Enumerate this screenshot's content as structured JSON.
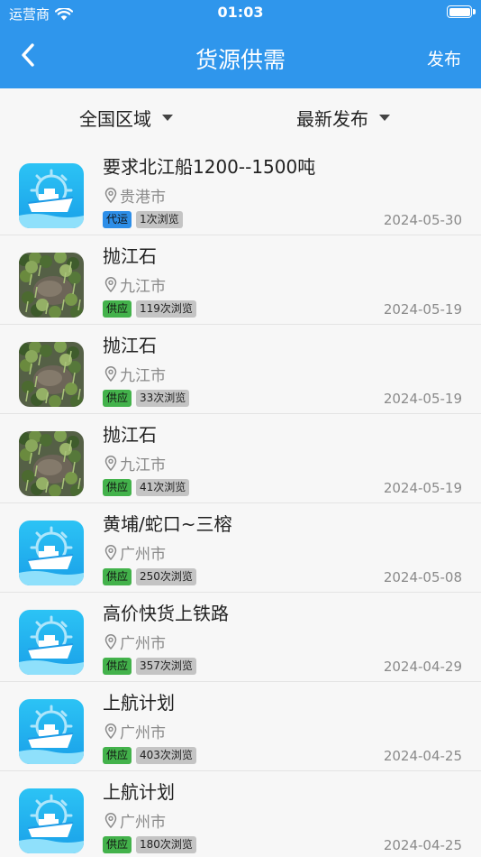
{
  "status_bar": {
    "carrier": "运营商",
    "time": "01:03"
  },
  "navbar": {
    "back_icon": "chevron-left-icon",
    "title": "货源供需",
    "publish_label": "发布"
  },
  "filters": {
    "region": "全国区域",
    "sort": "最新发布"
  },
  "colors": {
    "header": "#2f96ec",
    "tag_blue": "#2d8ee8",
    "tag_green": "#43b24b",
    "tag_gray": "#c4c4c4"
  },
  "items": [
    {
      "thumb": "ship-icon",
      "title": "要求北江船1200--1500吨",
      "location": "贵港市",
      "type": "代运",
      "type_color": "blue",
      "views": "1次浏览",
      "date": "2024-05-30"
    },
    {
      "thumb": "rock-photo",
      "title": "抛江石",
      "location": "九江市",
      "type": "供应",
      "type_color": "green",
      "views": "119次浏览",
      "date": "2024-05-19"
    },
    {
      "thumb": "rock-photo",
      "title": "抛江石",
      "location": "九江市",
      "type": "供应",
      "type_color": "green",
      "views": "33次浏览",
      "date": "2024-05-19"
    },
    {
      "thumb": "rock-photo",
      "title": "抛江石",
      "location": "九江市",
      "type": "供应",
      "type_color": "green",
      "views": "41次浏览",
      "date": "2024-05-19"
    },
    {
      "thumb": "ship-icon",
      "title": "黄埔/蛇口~三榕",
      "location": "广州市",
      "type": "供应",
      "type_color": "green",
      "views": "250次浏览",
      "date": "2024-05-08"
    },
    {
      "thumb": "ship-icon",
      "title": "高价快货上铁路",
      "location": "广州市",
      "type": "供应",
      "type_color": "green",
      "views": "357次浏览",
      "date": "2024-04-29"
    },
    {
      "thumb": "ship-icon",
      "title": "上航计划",
      "location": "广州市",
      "type": "供应",
      "type_color": "green",
      "views": "403次浏览",
      "date": "2024-04-25"
    },
    {
      "thumb": "ship-icon",
      "title": "上航计划",
      "location": "广州市",
      "type": "供应",
      "type_color": "green",
      "views": "180次浏览",
      "date": "2024-04-25"
    }
  ]
}
